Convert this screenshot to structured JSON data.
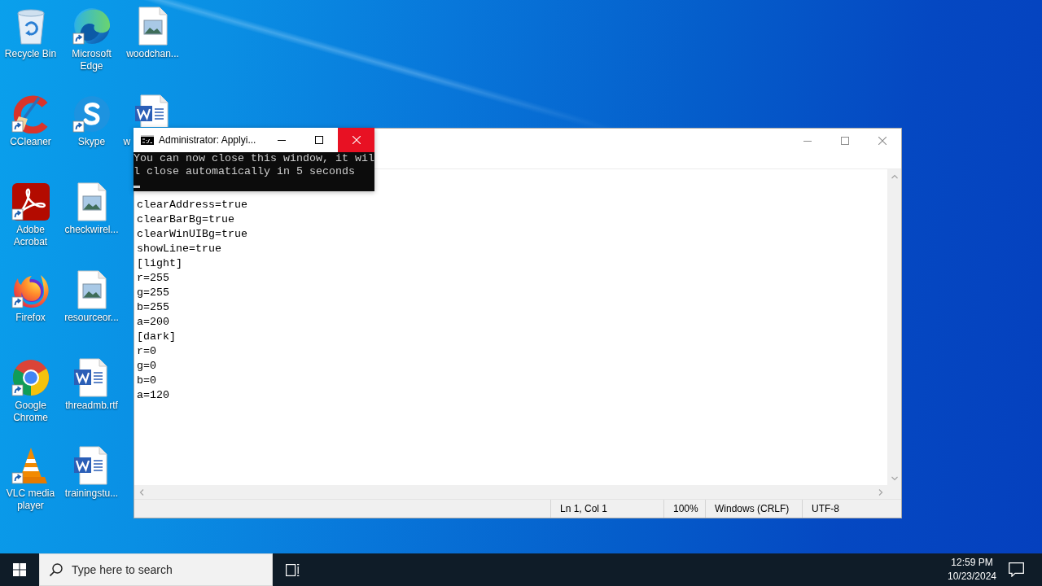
{
  "desktop": {
    "icons": [
      {
        "label": "Recycle Bin",
        "kind": "recycle-bin",
        "shortcut": false,
        "covered": false
      },
      {
        "label": "CCleaner",
        "kind": "ccleaner",
        "shortcut": true,
        "covered": false
      },
      {
        "label": "Adobe Acrobat",
        "kind": "acrobat",
        "shortcut": true,
        "covered": false
      },
      {
        "label": "Firefox",
        "kind": "firefox",
        "shortcut": true,
        "covered": false
      },
      {
        "label": "Google Chrome",
        "kind": "chrome",
        "shortcut": true,
        "covered": false
      },
      {
        "label": "VLC media player",
        "kind": "vlc",
        "shortcut": true,
        "covered": false
      },
      {
        "label": "Microsoft Edge",
        "kind": "edge",
        "shortcut": true,
        "covered": false
      },
      {
        "label": "Skype",
        "kind": "skype",
        "shortcut": true,
        "covered": false
      },
      {
        "label": "checkwirel...",
        "kind": "image-file",
        "shortcut": false,
        "covered": false
      },
      {
        "label": "resourceor...",
        "kind": "image-file",
        "shortcut": false,
        "covered": false
      },
      {
        "label": "threadmb.rtf",
        "kind": "word-file",
        "shortcut": false,
        "covered": false
      },
      {
        "label": "trainingstu...",
        "kind": "word-file",
        "shortcut": false,
        "covered": false
      },
      {
        "label": "woodchan...",
        "kind": "image-file",
        "shortcut": false,
        "covered": false
      },
      {
        "label": "w",
        "kind": "word-file",
        "shortcut": false,
        "covered": true
      }
    ]
  },
  "notepad_window": {
    "lines": [
      "clearAddress=true",
      "clearBarBg=true",
      "clearWinUIBg=true",
      "showLine=true",
      "[light]",
      "r=255",
      "g=255",
      "b=255",
      "a=200",
      "[dark]",
      "r=0",
      "g=0",
      "b=0",
      "a=120"
    ],
    "status_bar": {
      "position": "Ln 1, Col 1",
      "zoom": "100%",
      "line_ending": "Windows (CRLF)",
      "encoding": "UTF-8"
    }
  },
  "console_window": {
    "title": "Administrator: Applyi...",
    "close_hovered": true,
    "lines": [
      "You can now close this window, it wil",
      "l close automatically in 5 seconds"
    ]
  },
  "taskbar": {
    "search": {
      "placeholder": "Type here to search"
    },
    "clock": {
      "time": "12:59 PM",
      "date": "10/23/2024"
    }
  }
}
